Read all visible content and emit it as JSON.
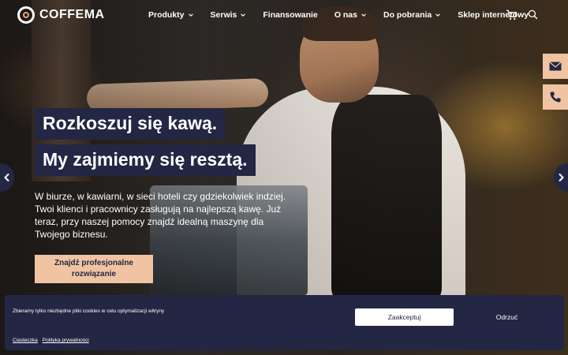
{
  "brand": {
    "name": "COFFEMA"
  },
  "nav": {
    "items": [
      {
        "label": "Produkty",
        "has_dropdown": true
      },
      {
        "label": "Serwis",
        "has_dropdown": true
      },
      {
        "label": "Finansowanie",
        "has_dropdown": false
      },
      {
        "label": "O nas",
        "has_dropdown": true
      },
      {
        "label": "Do pobrania",
        "has_dropdown": true
      },
      {
        "label": "Sklep internetowy",
        "has_dropdown": false
      }
    ],
    "icons": [
      "cart-icon",
      "search-icon"
    ]
  },
  "side_contact": {
    "icons": [
      "mail-icon",
      "phone-icon"
    ]
  },
  "hero": {
    "headline_1": "Rozkoszuj się kawą.",
    "headline_2": "My zajmiemy się resztą.",
    "lead": "W biurze, w kawiarni, w sieci hoteli czy gdziekolwiek indziej. Twoi klienci i pracownicy zasługują na najlepszą kawę. Już teraz, przy naszej pomocy znajdź idealną maszynę dla Twojego biznesu.",
    "cta_label": "Znajdź profesjonalne rozwiązanie"
  },
  "carousel": {
    "icons": [
      "chevron-left-icon",
      "chevron-right-icon"
    ]
  },
  "cookie_banner": {
    "text": "Zbieramy tylko niezbędne pliki cookies w celu optymalizacji witryny",
    "accept_label": "Zaakceptuj",
    "reject_label": "Odrzuć",
    "links": [
      "Ciasteczka",
      "Polityka prywatności"
    ]
  },
  "colors": {
    "navy": "#232744",
    "accent_peach": "#f0c4a2",
    "white": "#ffffff"
  }
}
